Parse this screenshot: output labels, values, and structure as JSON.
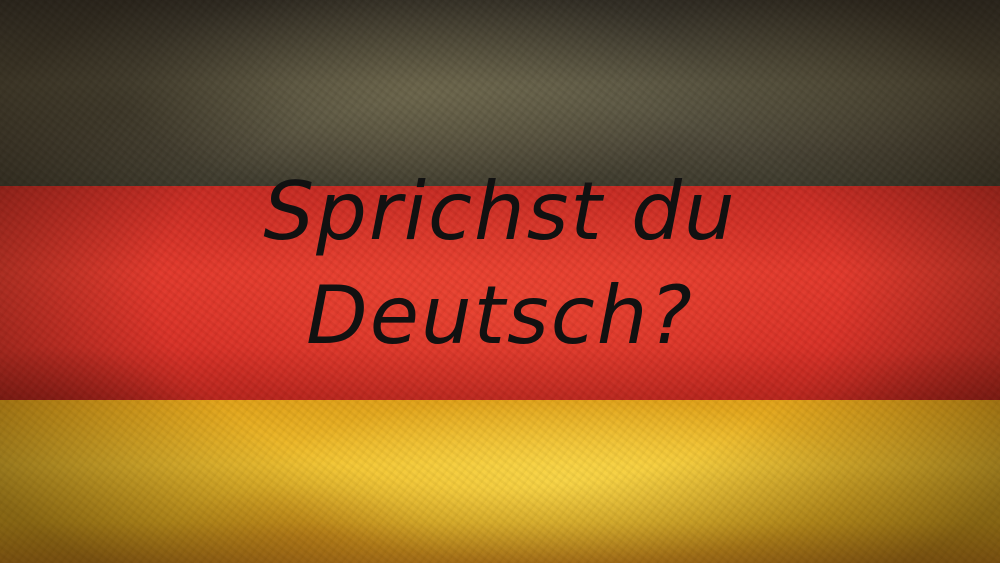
{
  "image": {
    "flag_colors": {
      "black_stripe": "#4a4536",
      "red_stripe": "#e2382b",
      "gold_stripe": "#f2c22e"
    },
    "headline": {
      "line1": "Sprichst du",
      "line2": "Deutsch?",
      "color": "#111111"
    }
  }
}
